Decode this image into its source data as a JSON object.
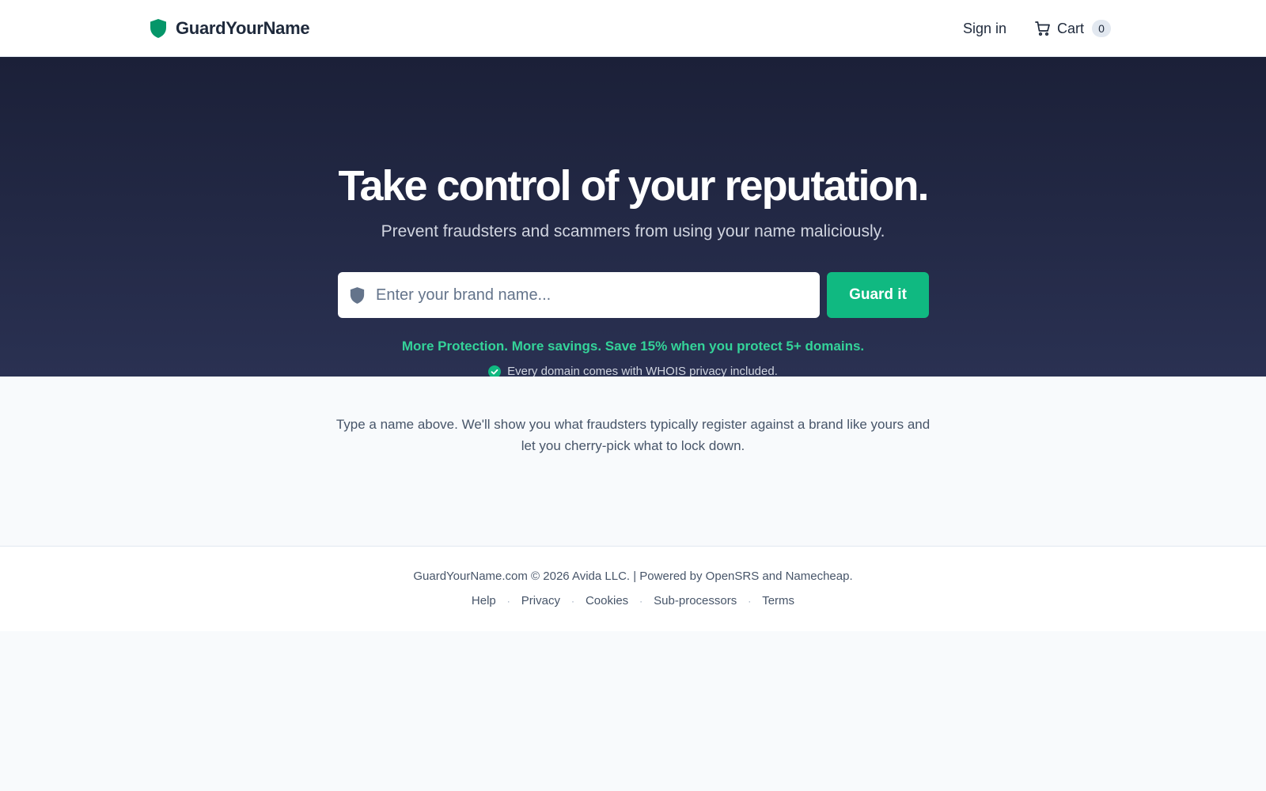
{
  "header": {
    "brand_name": "GuardYourName",
    "brand_icon": "shield-icon",
    "sign_in_label": "Sign in",
    "cart_label": "Cart",
    "cart_count": "0",
    "cart_icon": "cart-icon"
  },
  "hero": {
    "title": "Take control of your reputation.",
    "subtitle": "Prevent fraudsters and scammers from using your name maliciously.",
    "search": {
      "placeholder": "Enter your brand name...",
      "value": "",
      "icon": "shield-icon"
    },
    "guard_button_label": "Guard it",
    "promo": "More Protection. More savings. Save 15% when you protect 5+ domains.",
    "privacy_note": "Every domain comes with WHOIS privacy included.",
    "privacy_icon": "check-circle-icon"
  },
  "intro": {
    "text_line1": "Type a name above. We'll show you what fraudsters typically register against a brand like yours and",
    "text_line2": "let you cherry-pick what to lock down."
  },
  "footer": {
    "copyright": "GuardYourName.com © 2026 Avida LLC. | Powered by OpenSRS and Namecheap.",
    "links": [
      {
        "label": "Help"
      },
      {
        "label": "Privacy"
      },
      {
        "label": "Cookies"
      },
      {
        "label": "Sub-processors"
      },
      {
        "label": "Terms"
      }
    ],
    "separator": "·"
  },
  "colors": {
    "accent": "#10b981",
    "accent_text": "#34d399",
    "hero_bg_top": "#1b2038",
    "hero_bg_bottom": "#2a3152",
    "text_dark": "#1e293b",
    "text_muted": "#475569"
  }
}
